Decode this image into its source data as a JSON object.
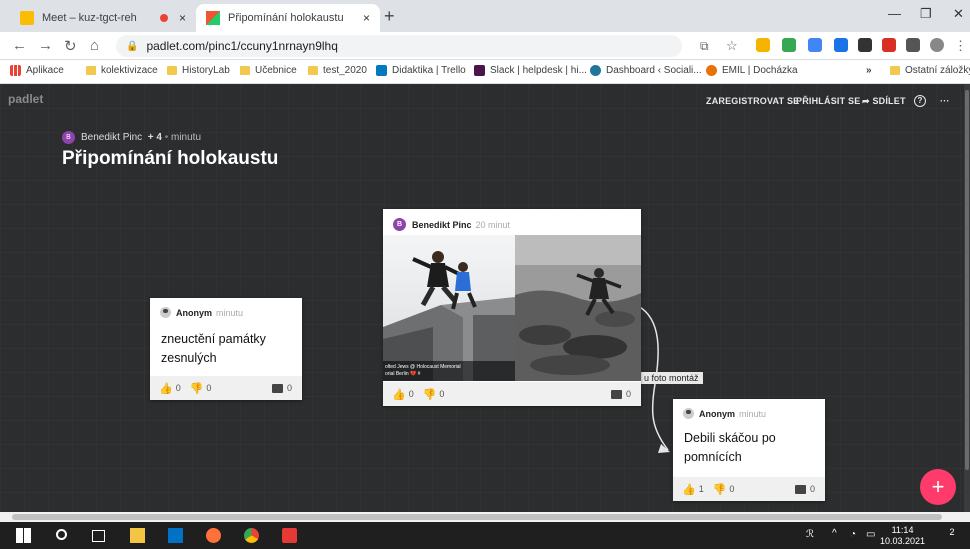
{
  "tabs": [
    {
      "label": "Meet – kuz-tgct-reh",
      "close": "×"
    },
    {
      "label": "Připomínání holokaustu",
      "close": "×"
    }
  ],
  "new_tab": "+",
  "url": "padlet.com/pinc1/ccuny1nrnayn9lhq",
  "bookmarks": [
    "Aplikace",
    "kolektivizace",
    "HistoryLab",
    "Učebnice",
    "test_2020",
    "Didaktika | Trello",
    "Slack | helpdesk | hi...",
    "Dashboard ‹ Sociali...",
    "EMIL | Docházka",
    "»",
    "Ostatní záložky"
  ],
  "app": {
    "logo": "padlet",
    "nav": {
      "register": "ZAREGISTROVAT SE",
      "login": "PŘIHLÁSIT SE",
      "share": "➦ SDÍLET",
      "help": "?",
      "more": "···"
    }
  },
  "board": {
    "author_initial": "B",
    "author": "Benedikt Pinc",
    "extra": "+ 4",
    "separator": "•",
    "time": "minutu",
    "title": "Připomínání holokaustu"
  },
  "posts": [
    {
      "author": "Anonym",
      "time": "minutu",
      "text_line1": "zneuctění památky",
      "text_line2": "zesnulých",
      "likes": "0",
      "dislikes": "0",
      "comments": "0"
    },
    {
      "author_initial": "B",
      "author": "Benedikt Pinc",
      "time": "20 minut",
      "caption": "olted Jews @ Holocaust Memorial",
      "caption2": "orial Berlin 💔 #",
      "likes": "0",
      "dislikes": "0",
      "comments": "0"
    },
    {
      "author": "Anonym",
      "time": "minutu",
      "text_line1": "Debili skáčou po",
      "text_line2": "pomnících",
      "likes": "1",
      "dislikes": "0",
      "comments": "0"
    }
  ],
  "connection_label": "u foto montáž",
  "fab": "+",
  "taskbar": {
    "time": "11:14",
    "date": "10.03.2021",
    "notify": "2"
  },
  "colors": {
    "board_bg": "#2c2d2e",
    "fab": "#ff3b6b",
    "avatar": "#8e44ad"
  }
}
